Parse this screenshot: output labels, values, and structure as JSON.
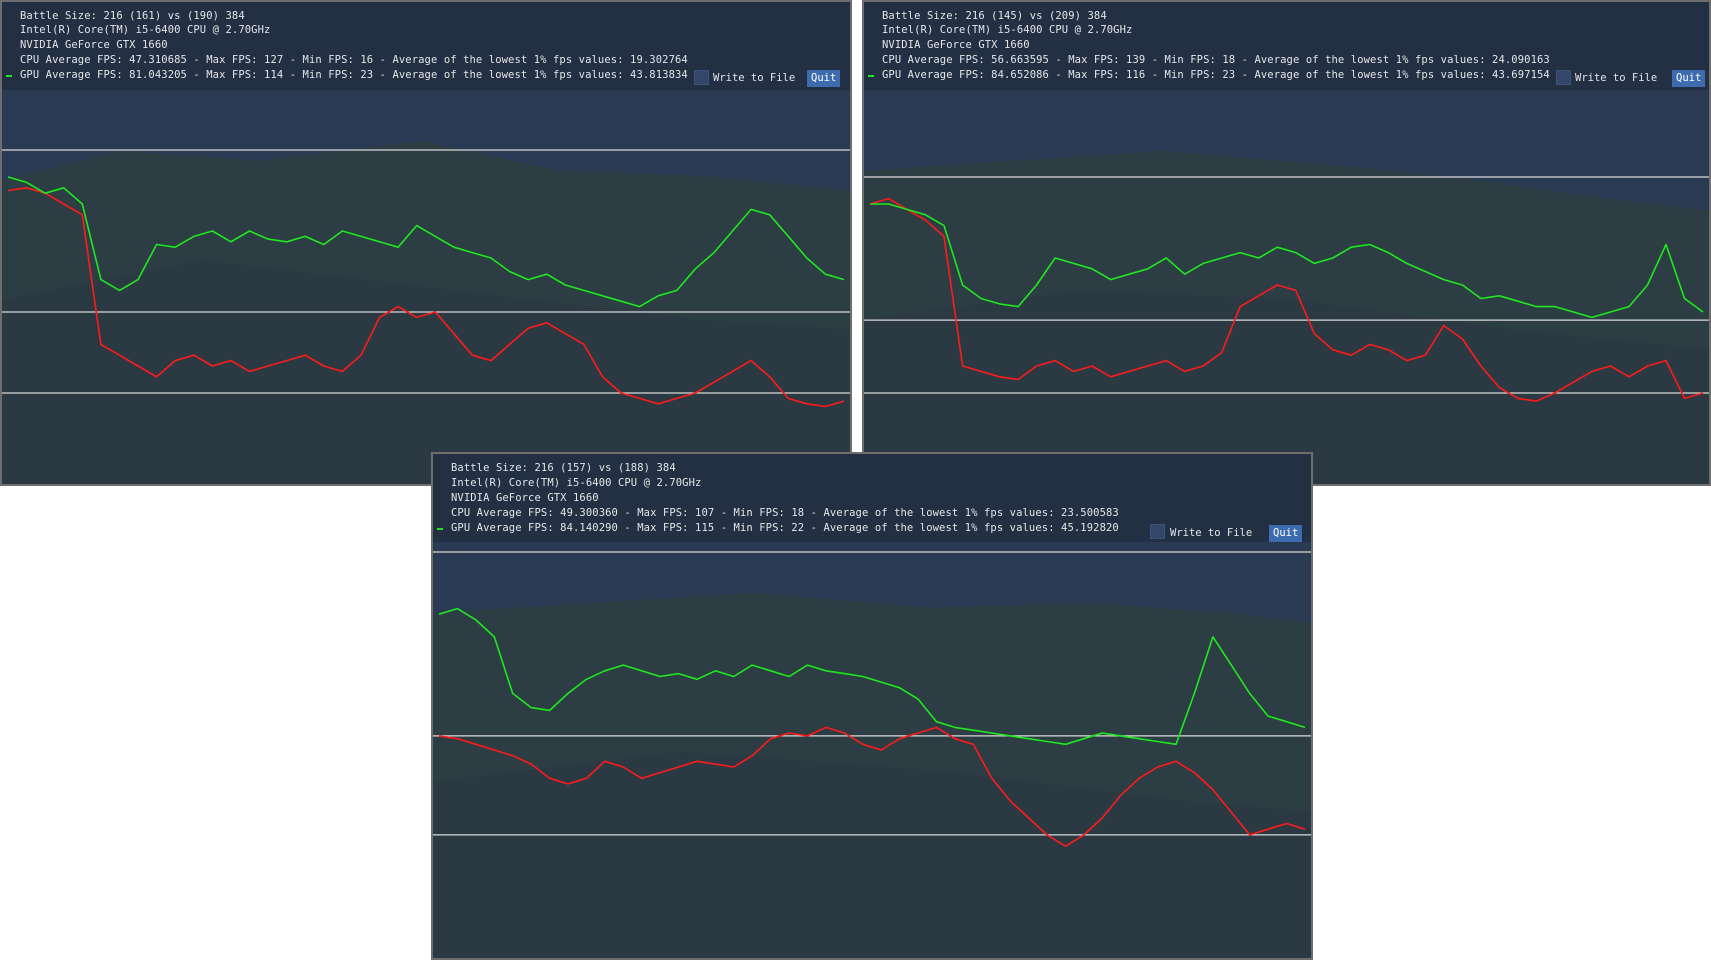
{
  "colors": {
    "panel_background": "#2c3b53",
    "cpu_line": "#ff1a1a",
    "gpu_line": "#1ee81e",
    "reference_line": "#d9d9d9",
    "quit_button": "#3d6cae"
  },
  "panels": [
    {
      "battle_size": "Battle Size: 216 (161) vs (190) 384",
      "cpu_name": "Intel(R) Core(TM) i5-6400 CPU @ 2.70GHz",
      "gpu_name": "NVIDIA GeForce GTX 1660",
      "cpu_stats": "CPU Average FPS: 47.310685 - Max FPS: 127 - Min FPS: 16 - Average of the lowest 1% fps values: 19.302764",
      "gpu_stats": "GPU Average FPS: 81.043205 - Max FPS: 114 - Min FPS: 23 - Average of the lowest 1% fps values: 43.813834",
      "write_label": "Write to File",
      "quit_label": "Quit"
    },
    {
      "battle_size": "Battle Size: 216 (145) vs (209) 384",
      "cpu_name": "Intel(R) Core(TM) i5-6400 CPU @ 2.70GHz",
      "gpu_name": "NVIDIA GeForce GTX 1660",
      "cpu_stats": "CPU Average FPS: 56.663595 - Max FPS: 139 - Min FPS: 18 - Average of the lowest 1% fps values: 24.090163",
      "gpu_stats": "GPU Average FPS: 84.652086 - Max FPS: 116 - Min FPS: 23 - Average of the lowest 1% fps values: 43.697154",
      "write_label": "Write to File",
      "quit_label": "Quit"
    },
    {
      "battle_size": "Battle Size: 216 (157) vs (188) 384",
      "cpu_name": "Intel(R) Core(TM) i5-6400 CPU @ 2.70GHz",
      "gpu_name": "NVIDIA GeForce GTX 1660",
      "cpu_stats": "CPU Average FPS: 49.300360 - Max FPS: 107 - Min FPS: 18 - Average of the lowest 1% fps values: 23.500583",
      "gpu_stats": "GPU Average FPS: 84.140290 - Max FPS: 115 - Min FPS: 22 - Average of the lowest 1% fps values: 45.192820",
      "write_label": "Write to File",
      "quit_label": "Quit"
    }
  ],
  "chart_data": [
    {
      "type": "line",
      "ylim": [
        0,
        140
      ],
      "reference_lines": [
        120,
        60,
        30
      ],
      "series": [
        {
          "name": "GPU",
          "color": "#1ee81e",
          "values": [
            110,
            108,
            104,
            106,
            100,
            72,
            68,
            72,
            85,
            84,
            88,
            90,
            86,
            90,
            87,
            86,
            88,
            85,
            90,
            88,
            86,
            84,
            92,
            88,
            84,
            82,
            80,
            75,
            72,
            74,
            70,
            68,
            66,
            64,
            62,
            66,
            68,
            76,
            82,
            90,
            98,
            96,
            88,
            80,
            74,
            72
          ]
        },
        {
          "name": "CPU",
          "color": "#ff1a1a",
          "values": [
            105,
            106,
            104,
            100,
            96,
            48,
            44,
            40,
            36,
            42,
            44,
            40,
            42,
            38,
            40,
            42,
            44,
            40,
            38,
            44,
            58,
            62,
            58,
            60,
            52,
            44,
            42,
            48,
            54,
            56,
            52,
            48,
            36,
            30,
            28,
            26,
            28,
            30,
            34,
            38,
            42,
            36,
            28,
            26,
            25,
            27
          ]
        }
      ]
    },
    {
      "type": "line",
      "ylim": [
        0,
        140
      ],
      "reference_lines": [
        110,
        57,
        30
      ],
      "series": [
        {
          "name": "GPU",
          "color": "#1ee81e",
          "values": [
            100,
            100,
            98,
            96,
            92,
            70,
            65,
            63,
            62,
            70,
            80,
            78,
            76,
            72,
            74,
            76,
            80,
            74,
            78,
            80,
            82,
            80,
            84,
            82,
            78,
            80,
            84,
            85,
            82,
            78,
            75,
            72,
            70,
            65,
            66,
            64,
            62,
            62,
            60,
            58,
            60,
            62,
            70,
            85,
            65,
            60
          ]
        },
        {
          "name": "CPU",
          "color": "#ff1a1a",
          "values": [
            100,
            102,
            98,
            94,
            88,
            40,
            38,
            36,
            35,
            40,
            42,
            38,
            40,
            36,
            38,
            40,
            42,
            38,
            40,
            45,
            62,
            66,
            70,
            68,
            52,
            46,
            44,
            48,
            46,
            42,
            44,
            55,
            50,
            40,
            32,
            28,
            27,
            30,
            34,
            38,
            40,
            36,
            40,
            42,
            28,
            30
          ]
        }
      ]
    },
    {
      "type": "line",
      "ylim": [
        0,
        140
      ],
      "reference_lines": [
        140,
        75,
        40
      ],
      "series": [
        {
          "name": "GPU",
          "color": "#1ee81e",
          "values": [
            118,
            120,
            116,
            110,
            90,
            85,
            84,
            90,
            95,
            98,
            100,
            98,
            96,
            97,
            95,
            98,
            96,
            100,
            98,
            96,
            100,
            98,
            97,
            96,
            94,
            92,
            88,
            80,
            78,
            77,
            76,
            75,
            74,
            73,
            72,
            74,
            76,
            75,
            74,
            73,
            72,
            90,
            110,
            100,
            90,
            82,
            80,
            78
          ]
        },
        {
          "name": "CPU",
          "color": "#ff1a1a",
          "values": [
            75,
            74,
            72,
            70,
            68,
            65,
            60,
            58,
            60,
            66,
            64,
            60,
            62,
            64,
            66,
            65,
            64,
            68,
            74,
            76,
            75,
            78,
            76,
            72,
            70,
            74,
            76,
            78,
            74,
            72,
            60,
            52,
            46,
            40,
            36,
            40,
            46,
            54,
            60,
            64,
            66,
            62,
            56,
            48,
            40,
            42,
            44,
            42
          ]
        }
      ]
    }
  ]
}
